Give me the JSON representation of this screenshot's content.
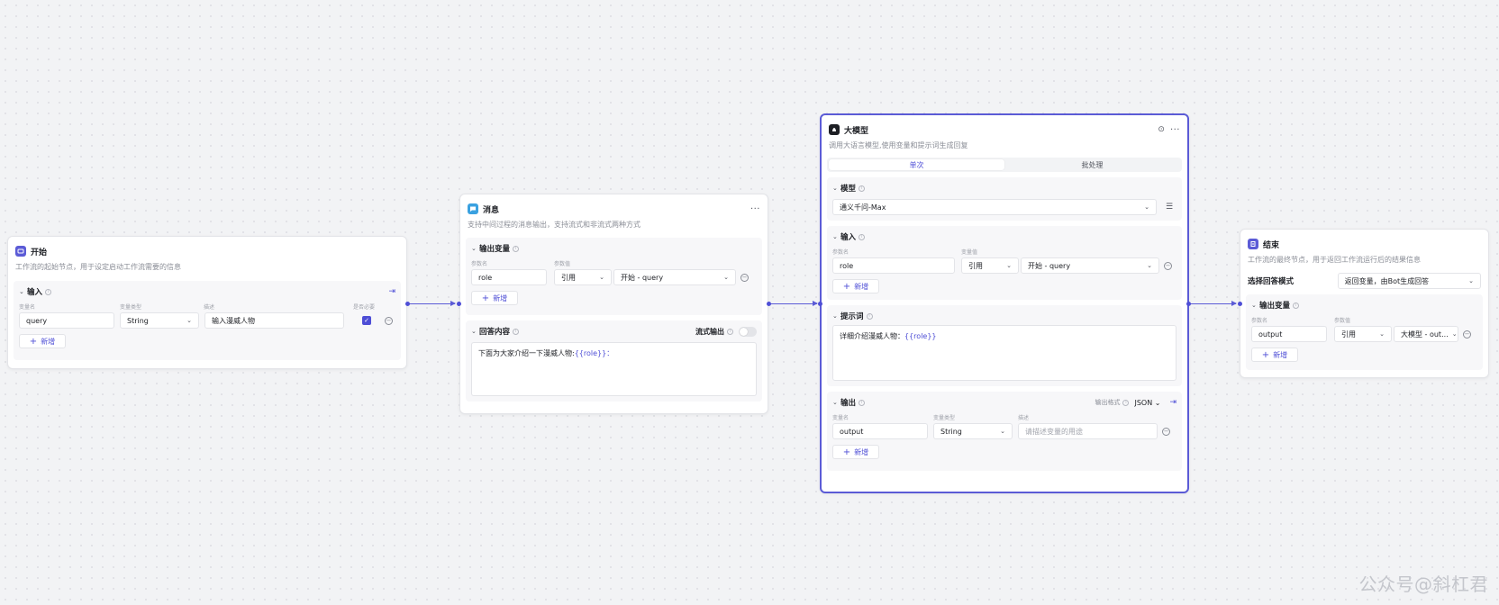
{
  "start": {
    "title": "开始",
    "desc": "工作流的起始节点，用于设定启动工作流需要的信息",
    "section_label": "输入",
    "columns": [
      "变量名",
      "变量类型",
      "描述",
      "是否必要"
    ],
    "row": {
      "name": "query",
      "type": "String",
      "desc": "输入漫威人物"
    },
    "add_label": "新增"
  },
  "message": {
    "title": "消息",
    "desc": "支持中间过程的消息输出，支持流式和非流式两种方式",
    "output_label": "输出变量",
    "columns": [
      "参数名",
      "参数值"
    ],
    "row": {
      "name": "role",
      "mode": "引用",
      "value": "开始 - query"
    },
    "add_label": "新增",
    "answer_label": "回答内容",
    "stream_label": "流式输出",
    "answer_text": "下面为大家介绍一下漫威人物:",
    "answer_var": "{{role}}："
  },
  "llm": {
    "title": "大模型",
    "desc": "调用大语言模型,使用变量和提示词生成回复",
    "tabs": [
      "单次",
      "批处理"
    ],
    "model_label": "模型",
    "model_value": "通义千问-Max",
    "input_label": "输入",
    "input_columns": [
      "参数名",
      "变量值"
    ],
    "input_row": {
      "name": "role",
      "mode": "引用",
      "value": "开始 - query"
    },
    "add_label": "新增",
    "prompt_label": "提示词",
    "prompt_text": "详细介绍漫威人物：",
    "prompt_var": "{{role}}",
    "output_label": "输出",
    "output_format_label": "输出格式",
    "output_format": "JSON",
    "output_columns": [
      "变量名",
      "变量类型",
      "描述"
    ],
    "output_row": {
      "name": "output",
      "type": "String",
      "desc_placeholder": "请描述变量的用途"
    }
  },
  "end": {
    "title": "结束",
    "desc": "工作流的最终节点，用于返回工作流运行后的结果信息",
    "mode_label": "选择回答模式",
    "mode_value": "返回变量，由Bot生成回答",
    "output_label": "输出变量",
    "columns": [
      "参数名",
      "参数值"
    ],
    "row": {
      "name": "output",
      "mode": "引用",
      "value": "大模型 - out..."
    },
    "add_label": "新增"
  },
  "watermark": "公众号@斜杠君",
  "colors": {
    "accent": "#4e4ed6",
    "selected_border": "#5b5bd6"
  }
}
